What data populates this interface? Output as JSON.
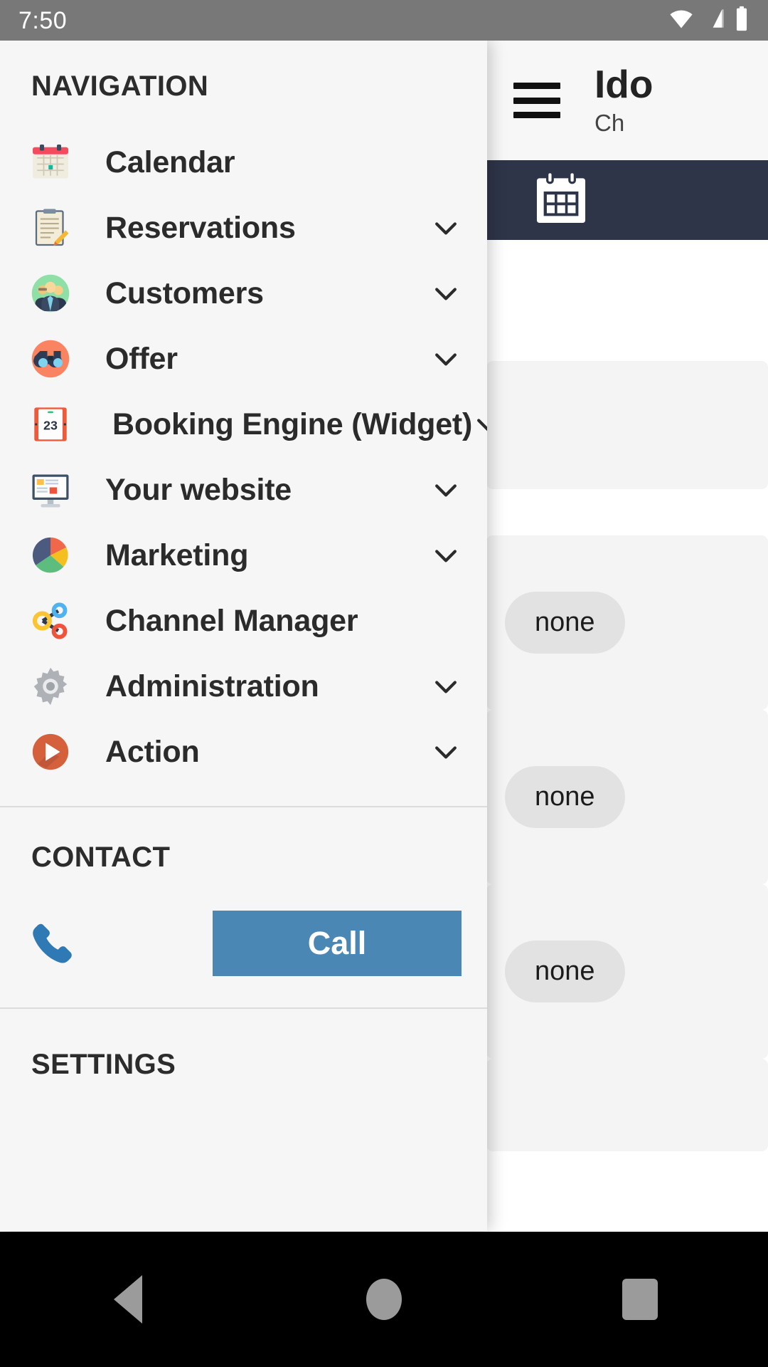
{
  "status_bar": {
    "time": "7:50",
    "icons": [
      "wifi-icon",
      "cellular-signal-icon",
      "battery-icon"
    ]
  },
  "app": {
    "title": "Ido",
    "subtitle": "Ch",
    "menu_icon": "hamburger-menu-icon",
    "toolbar_icon": "calendar-icon",
    "toolbar_color": "#2e3549",
    "cards": [
      {
        "pill": ""
      },
      {
        "pill": "none"
      },
      {
        "pill": "none"
      },
      {
        "pill": "none"
      }
    ]
  },
  "drawer": {
    "navigation": {
      "title": "NAVIGATION",
      "items": [
        {
          "label": "Calendar",
          "icon": "calendar-emoji-icon",
          "chevron": false,
          "indented": false
        },
        {
          "label": "Reservations",
          "icon": "clipboard-memo-icon",
          "chevron": true,
          "indented": false
        },
        {
          "label": "Customers",
          "icon": "people-group-icon",
          "chevron": true,
          "indented": false
        },
        {
          "label": "Offer",
          "icon": "binoculars-icon",
          "chevron": true,
          "indented": false
        },
        {
          "label": "Booking Engine (Widget)",
          "icon": "calendar-date-23-icon",
          "chevron": true,
          "indented": true
        },
        {
          "label": "Your website",
          "icon": "desktop-monitor-icon",
          "chevron": true,
          "indented": false
        },
        {
          "label": "Marketing",
          "icon": "pie-chart-icon",
          "chevron": true,
          "indented": false
        },
        {
          "label": "Channel Manager",
          "icon": "share-network-icon",
          "chevron": false,
          "indented": false
        },
        {
          "label": "Administration",
          "icon": "gear-icon",
          "chevron": true,
          "indented": false
        },
        {
          "label": "Action",
          "icon": "play-circle-icon",
          "chevron": true,
          "indented": false
        }
      ]
    },
    "contact": {
      "title": "CONTACT",
      "phone_icon": "phone-icon",
      "call_label": "Call",
      "call_color": "#4a87b5"
    },
    "settings": {
      "title": "SETTINGS"
    }
  },
  "system_nav": {
    "back": "back-button",
    "home": "home-button",
    "recents": "recents-button"
  }
}
